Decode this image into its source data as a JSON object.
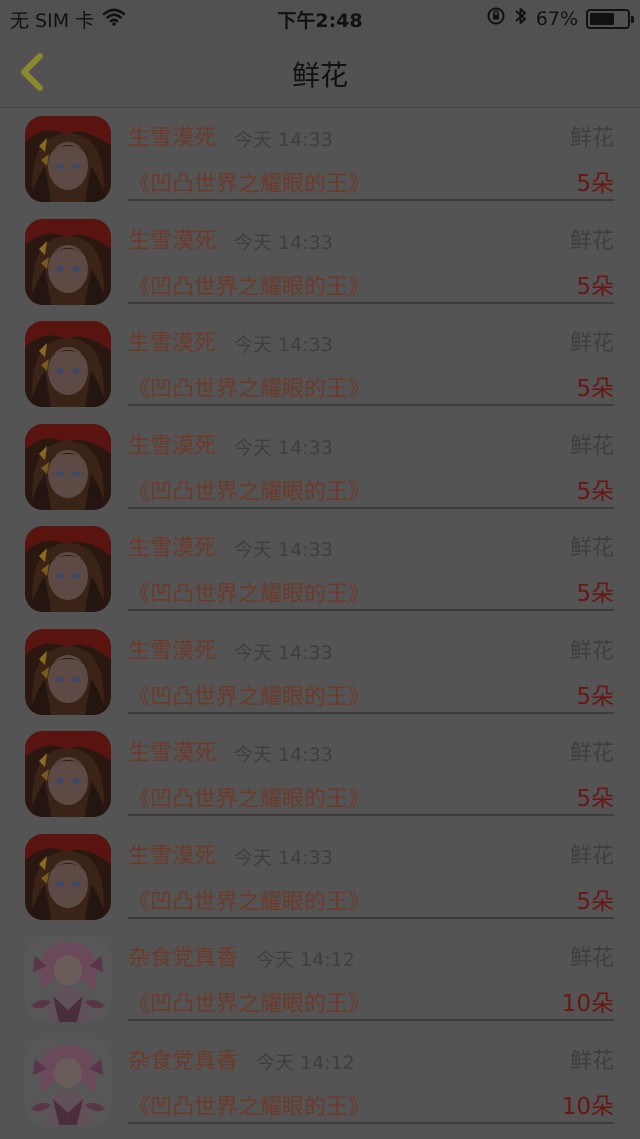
{
  "status_bar": {
    "carrier": "无 SIM 卡",
    "time": "下午2:48",
    "battery": "67%",
    "battery_level": 0.67
  },
  "nav": {
    "title": "鲜花",
    "back_icon": "chevron-left-icon",
    "back_color": "#8a8a2c"
  },
  "colors": {
    "name": "#6d3a2a",
    "count": "#6a1612",
    "muted": "#3e3e3e",
    "background": "#545454"
  },
  "items": [
    {
      "avatar": "dark-haired-girl",
      "name": "生雪漠死",
      "time": "今天 14:33",
      "type": "鲜花",
      "book": "《凹凸世界之耀眼的王》",
      "count": "5朵"
    },
    {
      "avatar": "dark-haired-girl",
      "name": "生雪漠死",
      "time": "今天 14:33",
      "type": "鲜花",
      "book": "《凹凸世界之耀眼的王》",
      "count": "5朵"
    },
    {
      "avatar": "dark-haired-girl",
      "name": "生雪漠死",
      "time": "今天 14:33",
      "type": "鲜花",
      "book": "《凹凸世界之耀眼的王》",
      "count": "5朵"
    },
    {
      "avatar": "dark-haired-girl",
      "name": "生雪漠死",
      "time": "今天 14:33",
      "type": "鲜花",
      "book": "《凹凸世界之耀眼的王》",
      "count": "5朵"
    },
    {
      "avatar": "dark-haired-girl",
      "name": "生雪漠死",
      "time": "今天 14:33",
      "type": "鲜花",
      "book": "《凹凸世界之耀眼的王》",
      "count": "5朵"
    },
    {
      "avatar": "dark-haired-girl",
      "name": "生雪漠死",
      "time": "今天 14:33",
      "type": "鲜花",
      "book": "《凹凸世界之耀眼的王》",
      "count": "5朵"
    },
    {
      "avatar": "dark-haired-girl",
      "name": "生雪漠死",
      "time": "今天 14:33",
      "type": "鲜花",
      "book": "《凹凸世界之耀眼的王》",
      "count": "5朵"
    },
    {
      "avatar": "dark-haired-girl",
      "name": "生雪漠死",
      "time": "今天 14:33",
      "type": "鲜花",
      "book": "《凹凸世界之耀眼的王》",
      "count": "5朵"
    },
    {
      "avatar": "pink-haired-girl",
      "name": "杂食党真香",
      "time": "今天 14:12",
      "type": "鲜花",
      "book": "《凹凸世界之耀眼的王》",
      "count": "10朵"
    },
    {
      "avatar": "pink-haired-girl",
      "name": "杂食党真香",
      "time": "今天 14:12",
      "type": "鲜花",
      "book": "《凹凸世界之耀眼的王》",
      "count": "10朵"
    }
  ]
}
